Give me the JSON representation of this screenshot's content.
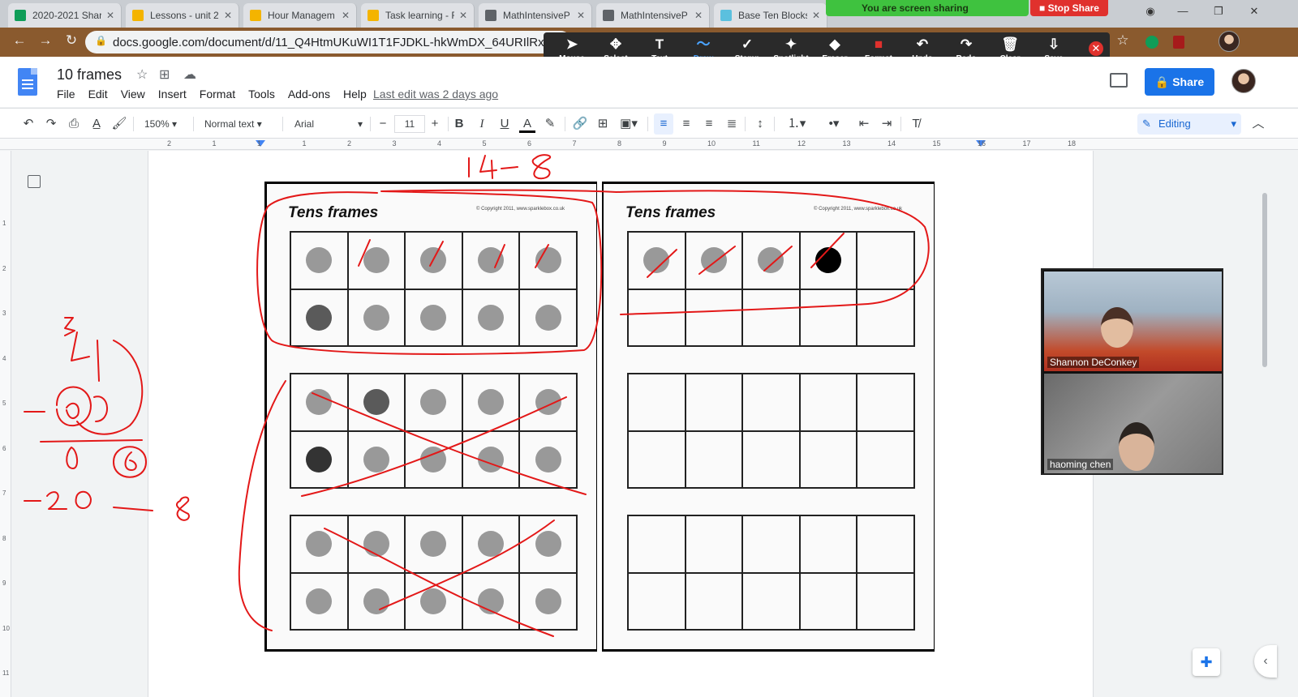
{
  "browser": {
    "tabs": [
      {
        "label": "2020-2021 Shar",
        "color": "#0f9d58"
      },
      {
        "label": "Lessons - unit 2",
        "color": "#f4b400"
      },
      {
        "label": "Hour Managem",
        "color": "#f4b400"
      },
      {
        "label": "Task learning - F",
        "color": "#f4b400"
      },
      {
        "label": "MathIntensiveP",
        "color": "#5f6368"
      },
      {
        "label": "MathIntensiveP",
        "color": "#5f6368"
      },
      {
        "label": "Base Ten Blocks",
        "color": "#5bc0de"
      }
    ],
    "url": "docs.google.com/document/d/11_Q4HtmUKuWI1T1FJDKL-hkWmDX_64URIlRxwIlWI8Y/e"
  },
  "zoom": {
    "sharing_banner": "You are screen sharing",
    "stop_share": "Stop Share",
    "tools": [
      {
        "label": "Mouse",
        "icon": "➤"
      },
      {
        "label": "Select",
        "icon": "✥"
      },
      {
        "label": "Text",
        "icon": "T"
      },
      {
        "label": "Draw",
        "icon": "〜"
      },
      {
        "label": "Stamp",
        "icon": "✓"
      },
      {
        "label": "Spotlight",
        "icon": "✦"
      },
      {
        "label": "Eraser",
        "icon": "◆"
      },
      {
        "label": "Format",
        "icon": "■"
      },
      {
        "label": "Undo",
        "icon": "↶"
      },
      {
        "label": "Redo",
        "icon": "↷"
      },
      {
        "label": "Clear",
        "icon": "🗑"
      },
      {
        "label": "Save",
        "icon": "⇩"
      }
    ],
    "active_tool": "Draw",
    "participants": [
      "Shannon DeConkey",
      "haoming chen"
    ]
  },
  "docs": {
    "title": "10 frames",
    "menu": [
      "File",
      "Edit",
      "View",
      "Insert",
      "Format",
      "Tools",
      "Add-ons",
      "Help"
    ],
    "last_edit": "Last edit was 2 days ago",
    "share_label": "Share",
    "zoom_level": "150%",
    "style": "Normal text",
    "font": "Arial",
    "font_size": "11",
    "mode": "Editing",
    "ruler_marks": [
      "2",
      "1",
      "1",
      "1",
      "2",
      "3",
      "4",
      "5",
      "6",
      "7",
      "8",
      "9",
      "10",
      "11",
      "12",
      "13",
      "14",
      "15",
      "16",
      "17",
      "18"
    ],
    "line_marks": [
      "1",
      "2",
      "3",
      "4",
      "5",
      "6",
      "7",
      "8",
      "9",
      "10",
      "11"
    ]
  },
  "worksheet": {
    "title": "Tens frames",
    "copyright": "© Copyright 2011, www.sparklebox.co.uk",
    "left_frames": [
      [
        1,
        1,
        1,
        1,
        1,
        2,
        1,
        1,
        1,
        1
      ],
      [
        1,
        2,
        1,
        1,
        1,
        3,
        1,
        1,
        1,
        1
      ],
      [
        1,
        1,
        1,
        1,
        1,
        1,
        1,
        1,
        1,
        1
      ]
    ],
    "right_frames": [
      [
        1,
        1,
        1,
        4,
        0,
        0,
        0,
        0,
        0,
        0
      ],
      [
        0,
        0,
        0,
        0,
        0,
        0,
        0,
        0,
        0,
        0
      ],
      [
        0,
        0,
        0,
        0,
        0,
        0,
        0,
        0,
        0,
        0
      ]
    ],
    "dot_colors": {
      "1": "#999999",
      "2": "#5a5a5a",
      "3": "#333333",
      "4": "#000000"
    }
  },
  "handwriting": {
    "top": "14-8",
    "minus_twenty": "-20",
    "eight": "8"
  }
}
